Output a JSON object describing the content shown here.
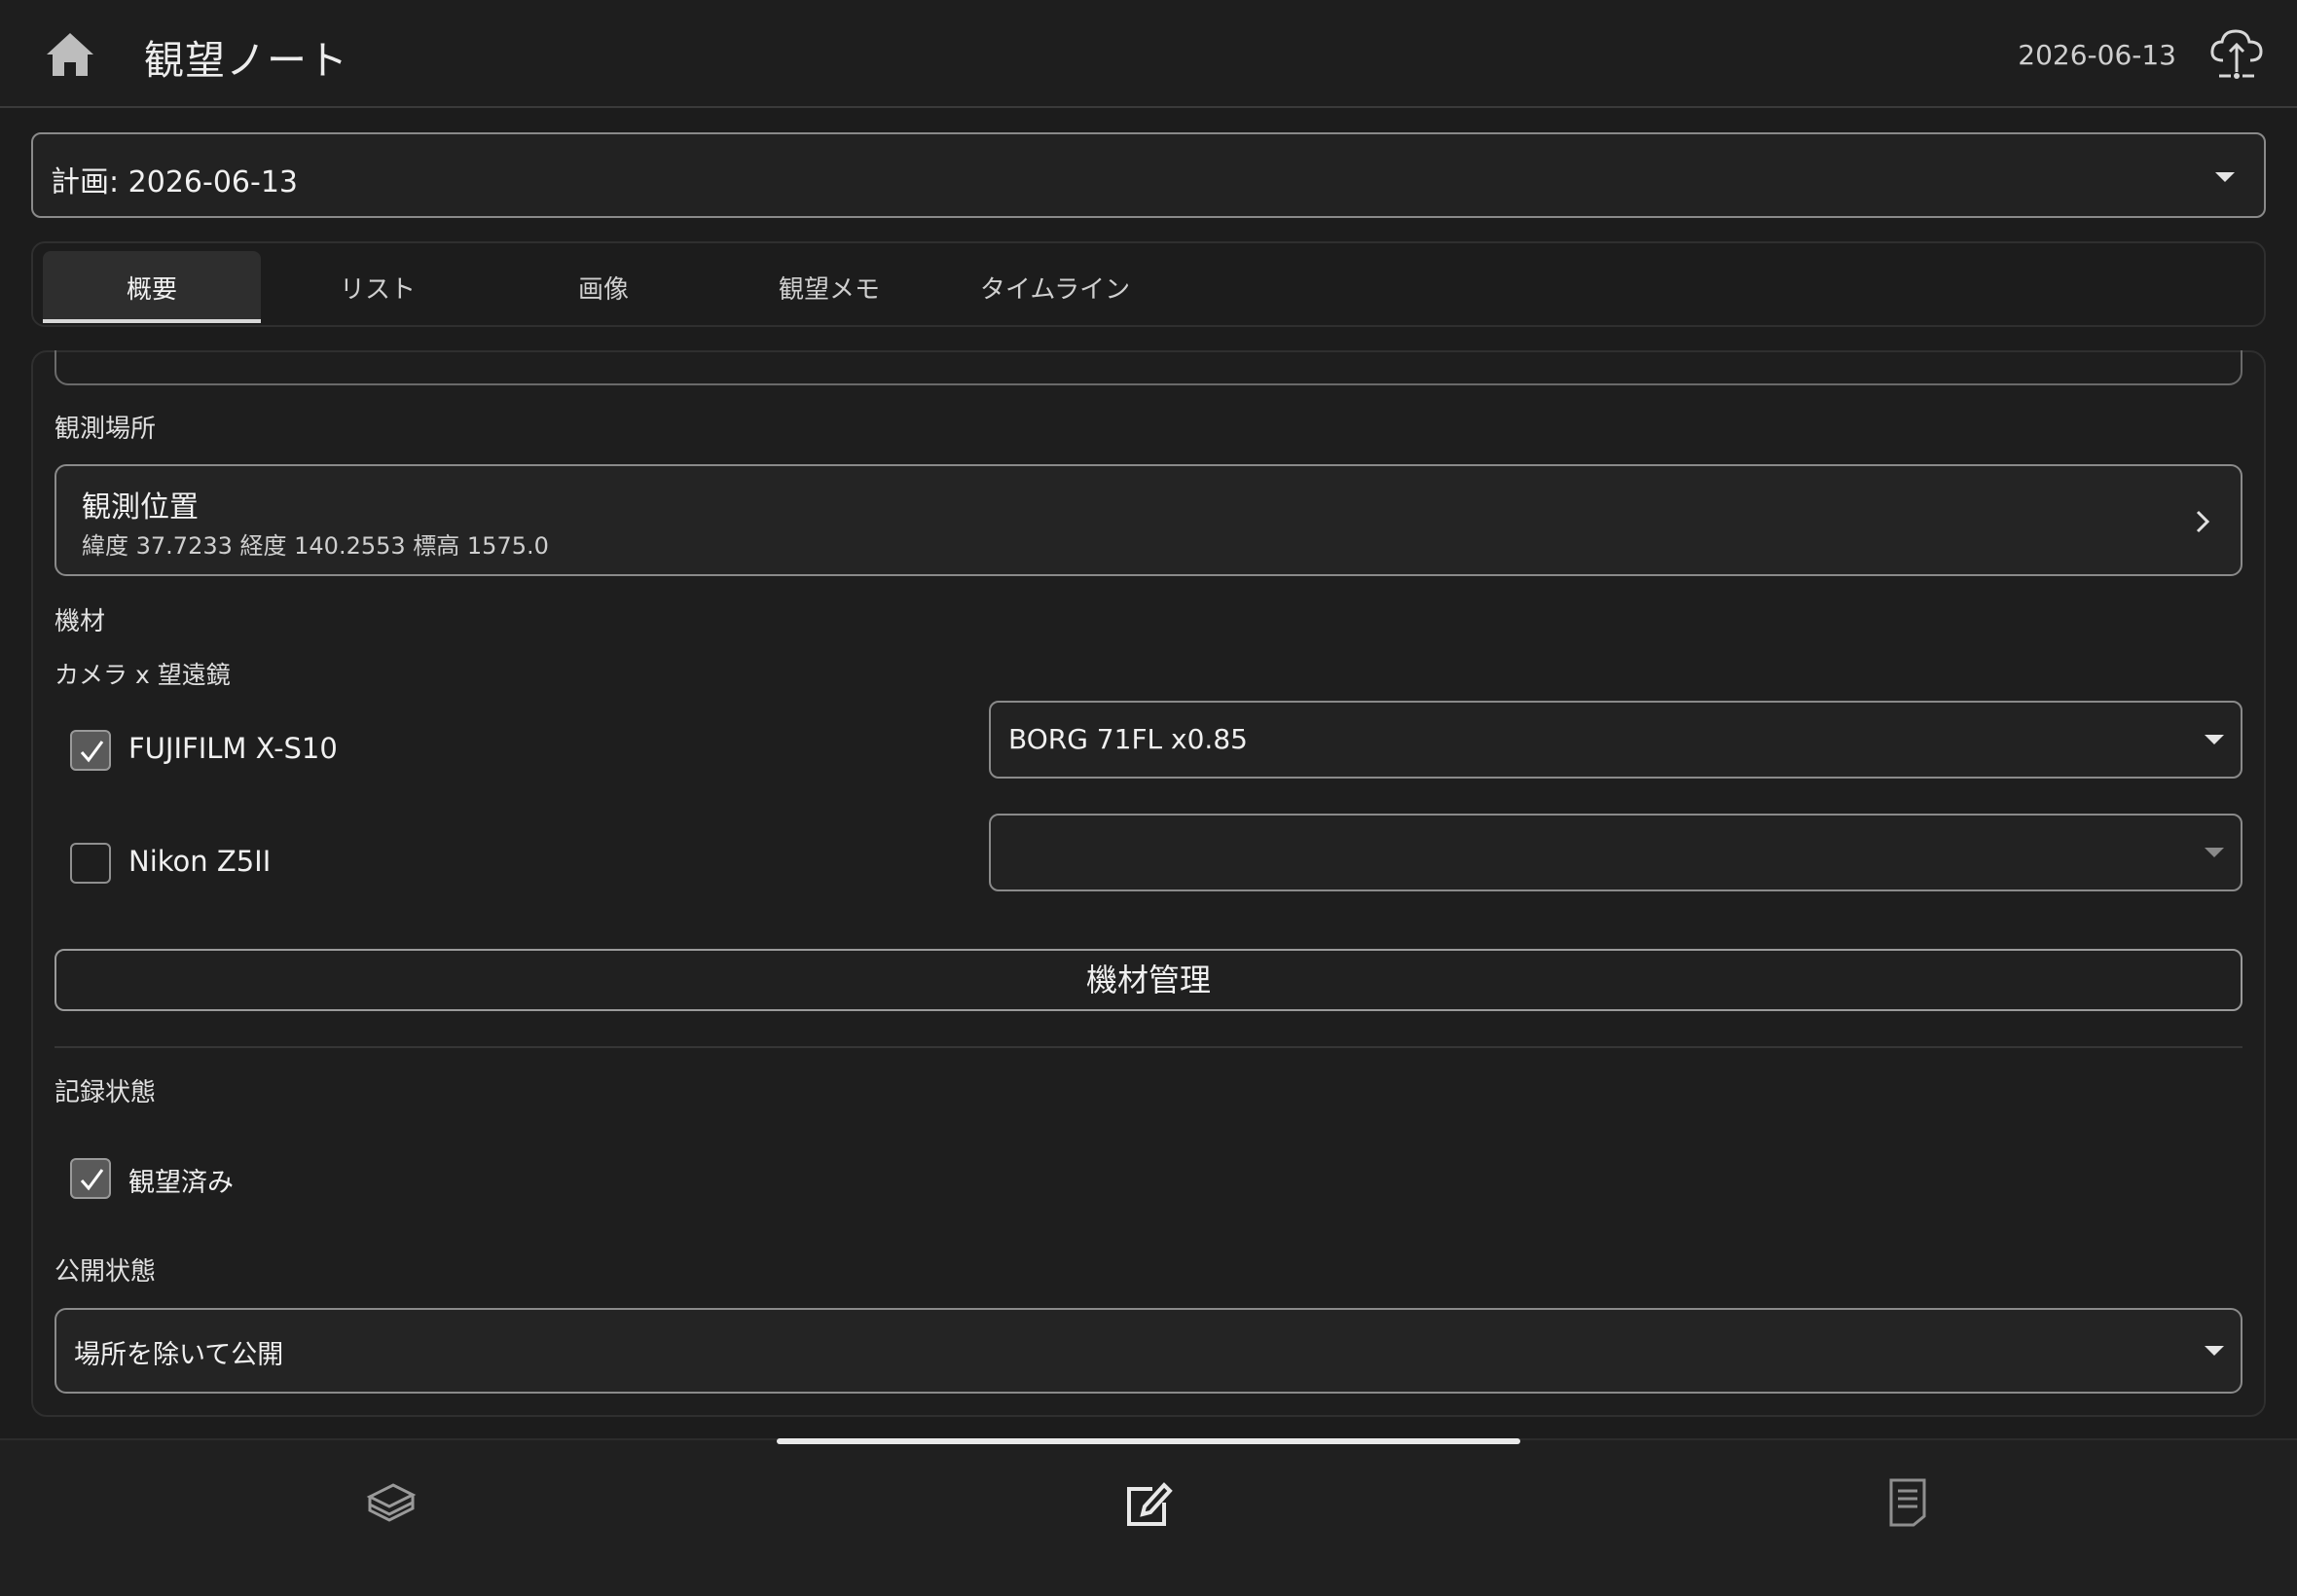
{
  "header": {
    "title": "観望ノート",
    "date": "2026-06-13",
    "home_icon": "home-icon",
    "sync_icon": "cloud-upload-icon"
  },
  "plan_select": {
    "value": "計画: 2026-06-13"
  },
  "tabs": [
    {
      "label": "概要",
      "selected": true
    },
    {
      "label": "リスト"
    },
    {
      "label": "画像"
    },
    {
      "label": "観望メモ"
    },
    {
      "label": "タイムライン"
    }
  ],
  "location": {
    "section_label": "観測場所",
    "title": "観測位置",
    "details": "緯度 37.7233 経度 140.2553 標高 1575.0"
  },
  "equipment": {
    "section_label": "機材",
    "combo_label": "カメラ x 望遠鏡",
    "rows": [
      {
        "camera": "FUJIFILM X-S10",
        "checked": true,
        "telescope": "BORG 71FL x0.85"
      },
      {
        "camera": "Nikon Z5II",
        "checked": false,
        "telescope": ""
      }
    ],
    "manage_button": "機材管理"
  },
  "record": {
    "section_label": "記録状態",
    "observed_label": "観望済み",
    "observed_checked": true
  },
  "publish": {
    "section_label": "公開状態",
    "value": "場所を除いて公開"
  },
  "bottom_nav": [
    "book-stack-icon",
    "edit-note-icon",
    "document-list-icon"
  ],
  "colors": {
    "background": "#1c1c1c",
    "border": "#8a8a8a",
    "text": "#e6e6e6"
  }
}
